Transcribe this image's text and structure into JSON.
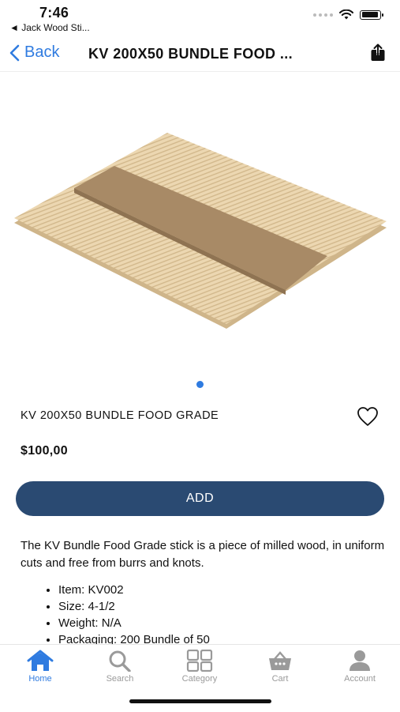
{
  "status": {
    "time": "7:46",
    "back_app": "◄ Jack Wood Sti..."
  },
  "nav": {
    "back_label": "Back",
    "title": "KV 200X50 BUNDLE FOOD ..."
  },
  "product": {
    "title": "KV 200X50 BUNDLE FOOD GRADE",
    "price": "$100,00",
    "add_label": "ADD",
    "description": "The KV Bundle Food Grade stick is a piece of milled wood, in uniform cuts and free from burrs and knots.",
    "details": [
      "Item: KV002",
      "Size: 4-1/2",
      "Weight: N/A",
      "Packaging: 200 Bundle of 50"
    ]
  },
  "tabs": [
    {
      "label": "Home",
      "icon": "home-icon",
      "active": true
    },
    {
      "label": "Search",
      "icon": "search-icon",
      "active": false
    },
    {
      "label": "Category",
      "icon": "category-icon",
      "active": false
    },
    {
      "label": "Cart",
      "icon": "cart-icon",
      "active": false
    },
    {
      "label": "Account",
      "icon": "account-icon",
      "active": false
    }
  ],
  "colors": {
    "accent": "#2f7be0",
    "button": "#2a4a72",
    "inactive": "#9a9a9a"
  }
}
